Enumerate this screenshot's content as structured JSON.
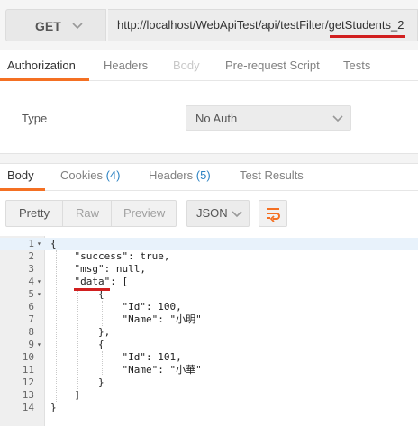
{
  "request": {
    "method": "GET",
    "url": "http://localhost/WebApiTest/api/testFilter/getStudents_2"
  },
  "request_tabs": [
    {
      "label": "Authorization",
      "state": "active"
    },
    {
      "label": "Headers",
      "state": "normal"
    },
    {
      "label": "Body",
      "state": "disabled"
    },
    {
      "label": "Pre-request Script",
      "state": "normal"
    },
    {
      "label": "Tests",
      "state": "normal"
    }
  ],
  "auth": {
    "type_label": "Type",
    "selected": "No Auth"
  },
  "response_tabs": {
    "body": "Body",
    "cookies": "Cookies",
    "cookies_count": "(4)",
    "headers": "Headers",
    "headers_count": "(5)",
    "test_results": "Test Results"
  },
  "toolbar": {
    "pretty": "Pretty",
    "raw": "Raw",
    "preview": "Preview",
    "language": "JSON"
  },
  "code_lines": [
    {
      "n": "1",
      "text": "{"
    },
    {
      "n": "2",
      "text": "    \"success\": true,"
    },
    {
      "n": "3",
      "text": "    \"msg\": null,"
    },
    {
      "n": "4",
      "text": "    \"data\": ["
    },
    {
      "n": "5",
      "text": "        {"
    },
    {
      "n": "6",
      "text": "            \"Id\": 100,"
    },
    {
      "n": "7",
      "text": "            \"Name\": \"小明\""
    },
    {
      "n": "8",
      "text": "        },"
    },
    {
      "n": "9",
      "text": "        {"
    },
    {
      "n": "10",
      "text": "            \"Id\": 101,"
    },
    {
      "n": "11",
      "text": "            \"Name\": \"小華\""
    },
    {
      "n": "12",
      "text": "        }"
    },
    {
      "n": "13",
      "text": "    ]"
    },
    {
      "n": "14",
      "text": "}"
    }
  ],
  "colors": {
    "accent": "#f47023",
    "count_blue": "#2e84c4",
    "annotation_red": "#d11f1f"
  },
  "icons": {
    "method_dropdown": "chevron-down-icon",
    "auth_dropdown": "chevron-down-icon",
    "language_dropdown": "chevron-down-icon",
    "wrap": "wrap-lines-icon",
    "fold": "fold-arrow-icon"
  }
}
